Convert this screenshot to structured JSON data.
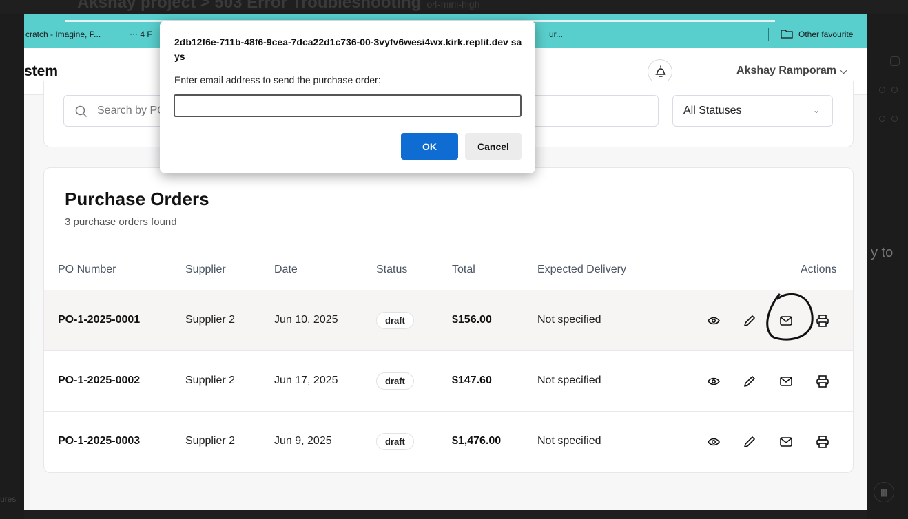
{
  "background": {
    "breadcrumb": "Akshay project > 503 Error Troubleshooting",
    "model_label": "o4-mini-high",
    "right_partial_text": "y to",
    "bottom_left_text": "ures"
  },
  "bookmarks": {
    "items": [
      "cratch - Imagine, P...",
      "4 F",
      "ur..."
    ],
    "other_favourites": "Other favourite"
  },
  "app": {
    "title": "stem",
    "user_name": "Akshay Ramporam"
  },
  "filters": {
    "search_placeholder": "Search by PO",
    "status_value": "All Statuses"
  },
  "orders": {
    "title": "Purchase Orders",
    "subtitle": "3 purchase orders found",
    "columns": [
      "PO Number",
      "Supplier",
      "Date",
      "Status",
      "Total",
      "Expected Delivery",
      "Actions"
    ],
    "rows": [
      {
        "po": "PO-1-2025-0001",
        "supplier": "Supplier 2",
        "date": "Jun 10, 2025",
        "status": "draft",
        "total": "$156.00",
        "delivery": "Not specified"
      },
      {
        "po": "PO-1-2025-0002",
        "supplier": "Supplier 2",
        "date": "Jun 17, 2025",
        "status": "draft",
        "total": "$147.60",
        "delivery": "Not specified"
      },
      {
        "po": "PO-1-2025-0003",
        "supplier": "Supplier 2",
        "date": "Jun 9, 2025",
        "status": "draft",
        "total": "$1,476.00",
        "delivery": "Not specified"
      }
    ],
    "action_icons": [
      "eye-icon",
      "pencil-icon",
      "mail-icon",
      "printer-icon"
    ]
  },
  "dialog": {
    "origin": "2db12f6e-711b-48f6-9cea-7dca22d1c736-00-3vyfv6wesi4wx.kirk.replit.dev says",
    "message": "Enter email address to send the purchase order:",
    "input_value": "",
    "ok_label": "OK",
    "cancel_label": "Cancel"
  },
  "colors": {
    "bookmark_bar": "#59cfcd",
    "ok_button": "#0f6cd3",
    "annotation": "#111111"
  }
}
